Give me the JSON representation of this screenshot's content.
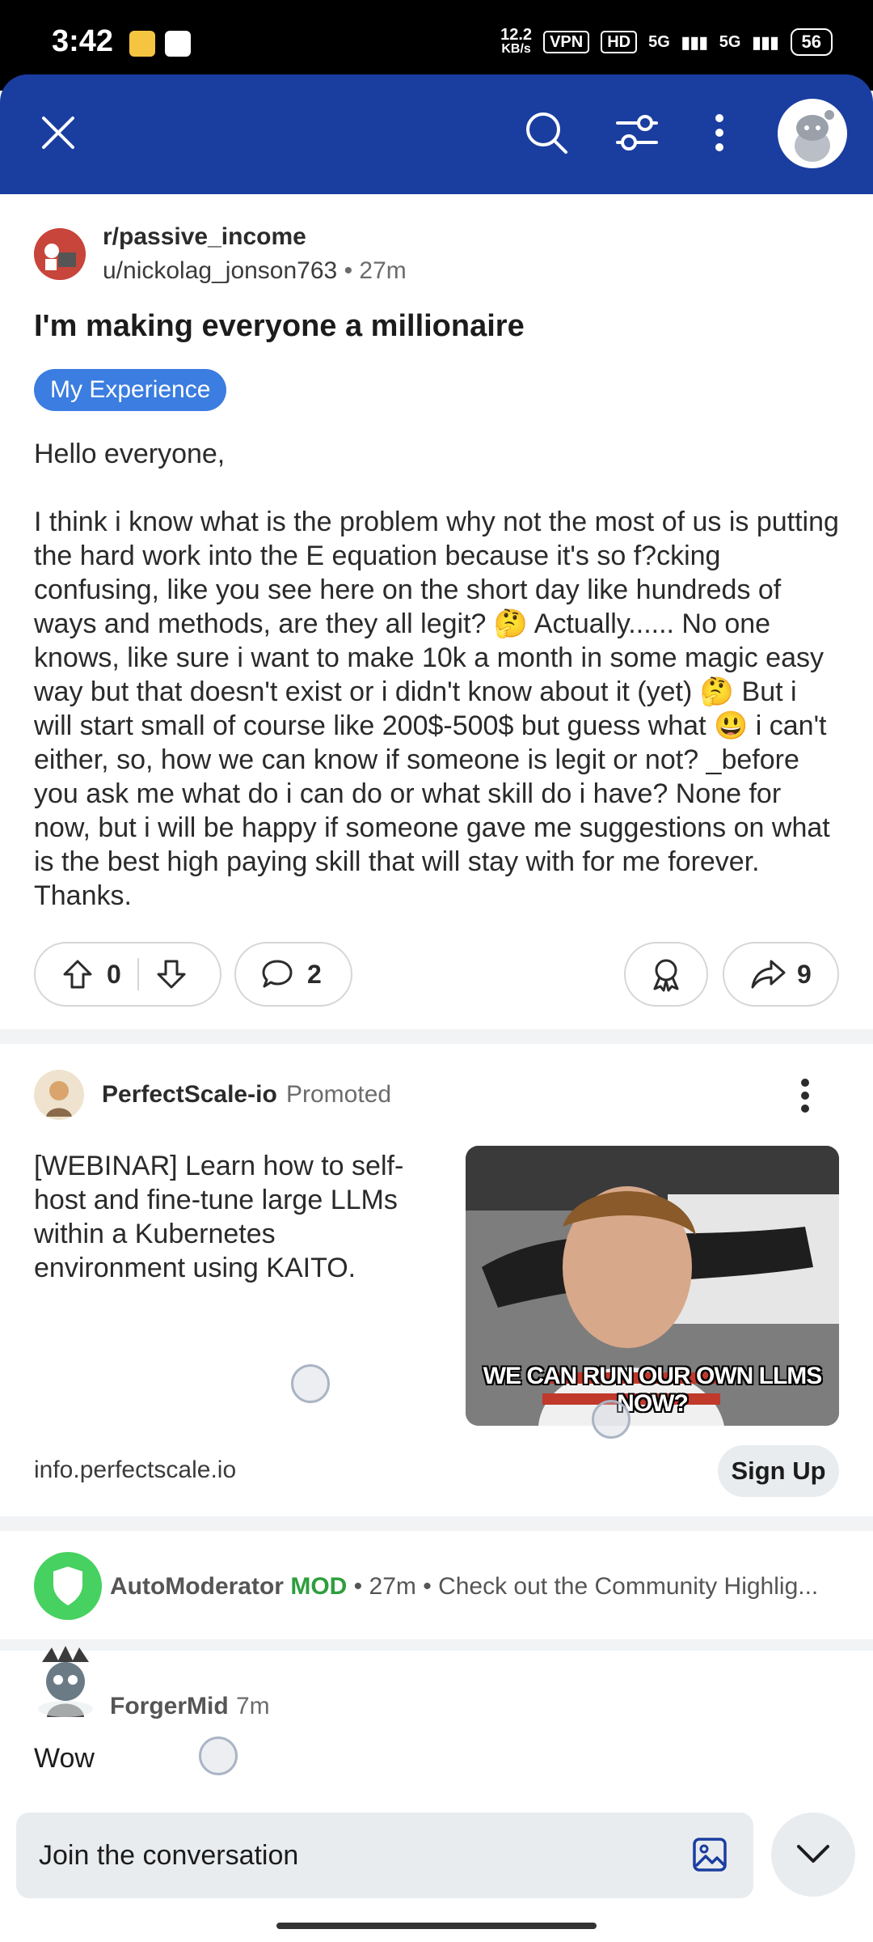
{
  "status_bar": {
    "time": "3:42",
    "net_speed_top": "12.2",
    "net_speed_bottom": "KB/s",
    "vpn": "VPN",
    "hd": "HD",
    "signal1": "5G",
    "signal2": "5G",
    "battery": "56"
  },
  "toolbar": {
    "close_icon": "close-icon",
    "search_icon": "search-icon",
    "filter_icon": "sort-filter-icon",
    "more_icon": "more-vertical-icon",
    "avatar": "user-avatar"
  },
  "post": {
    "subreddit": "r/passive_income",
    "author": "u/nickolag_jonson763",
    "age": "27m",
    "title": "I'm making everyone a millionaire",
    "flair": "My Experience",
    "body": "Hello everyone,\n\nI think i know what is the problem why not the most of us is putting the hard work into the E equation because it's so f?cking confusing, like you see here on the short day like hundreds of ways and methods, are they all legit? 🤔 Actually...... No one knows, like sure i want to make 10k a month in some magic easy way but that doesn't exist or i didn't know about it (yet) 🤔 But i will start small of course like 200$-500$ but guess what 😃 i can't either, so, how we can know if someone is legit or not? _before you ask me what do i can do or what skill do i have? None for now, but i will be happy if someone gave me suggestions on what is the best high paying skill that will stay with for me forever. Thanks.",
    "votes": "0",
    "comments": "2",
    "shares": "9"
  },
  "ad": {
    "advertiser": "PerfectScale-io",
    "promoted_label": "Promoted",
    "text": "[WEBINAR] Learn how to self-host and fine-tune large LLMs within a Kubernetes environment using KAITO.",
    "image_caption": "WE CAN RUN OUR OWN LLMS NOW?",
    "domain": "info.perfectscale.io",
    "cta": "Sign Up"
  },
  "automod": {
    "name": "AutoModerator",
    "badge": "MOD",
    "age": "27m",
    "snippet": "Check out the Community Highlig..."
  },
  "comment": {
    "author": "ForgerMid",
    "age": "7m",
    "text": "Wow"
  },
  "composer": {
    "placeholder": "Join the conversation"
  }
}
